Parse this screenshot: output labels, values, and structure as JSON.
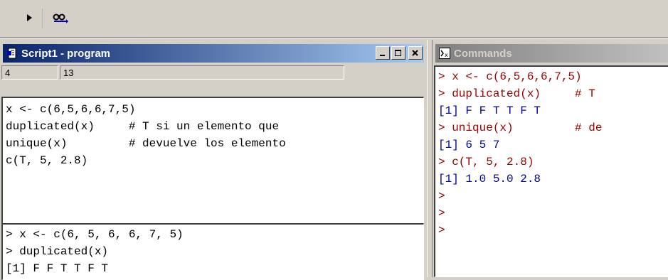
{
  "toolbar": {
    "run_icon": "play-icon",
    "find_icon": "binoculars-icon"
  },
  "script_window": {
    "title": "Script1 - program",
    "status": {
      "line": "4",
      "col": "13"
    },
    "code_lines": [
      "x <- c(6,5,6,6,7,5)",
      "duplicated(x)     # T si un elemento que",
      "unique(x)         # devuelve los elemento",
      "c(T, 5, 2.8)"
    ],
    "output_lines": [
      "> x <- c(6, 5, 6, 6, 7, 5)",
      "> duplicated(x)",
      "[1] F F T T F T"
    ]
  },
  "commands_window": {
    "title": "Commands",
    "lines": [
      {
        "text": "> x <- c(6,5,6,6,7,5)",
        "kind": "command"
      },
      {
        "text": "> duplicated(x)     # T",
        "kind": "command"
      },
      {
        "text": "[1] F F T T F T",
        "kind": "output"
      },
      {
        "text": "> unique(x)         # de",
        "kind": "command"
      },
      {
        "text": "[1] 6 5 7",
        "kind": "output"
      },
      {
        "text": "> c(T, 5, 2.8)",
        "kind": "command"
      },
      {
        "text": "[1] 1.0 5.0 2.8",
        "kind": "output"
      },
      {
        "text": ">",
        "kind": "command"
      },
      {
        "text": ">",
        "kind": "command"
      },
      {
        "text": ">",
        "kind": "command"
      }
    ]
  },
  "colors": {
    "active_title": "#0a246a",
    "command_text": "#a00000",
    "output_text": "#0000a0"
  }
}
